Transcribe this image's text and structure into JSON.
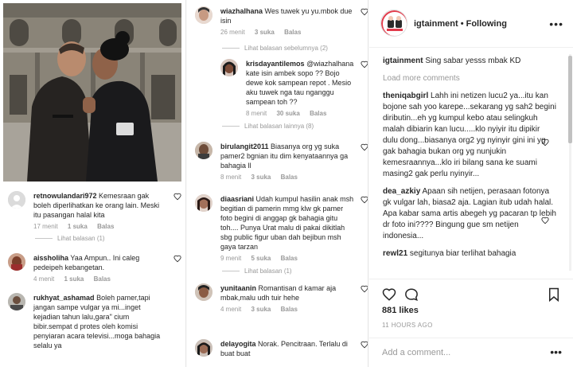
{
  "col1": {
    "comments": [
      {
        "user": "retnowulandari972",
        "text": "Kemesraan gak boleh diperlihatkan ke orang lain. Meski itu pasangan halal kita",
        "time": "17 menit",
        "likes": "1 suka",
        "reply": "Balas"
      },
      {
        "user": "aissholiha",
        "text": "Yaa Ampun.. Ini caleg pedeipeh kebangetan.",
        "time": "4 menit",
        "likes": "1 suka",
        "reply": "Balas"
      },
      {
        "user": "rukhyat_ashamad",
        "text": "Boleh pamer,tapi jangan sampe vulgar ya mi...inget kejadian tahun lalu,gara\" cium bibir.sempat d protes oleh komisi penyiaran acara televisi...moga bahagia selalu ya",
        "time": "",
        "likes": "",
        "reply": ""
      }
    ],
    "view_replies": "Lihat balasan (1)"
  },
  "col2": {
    "comments": [
      {
        "user": "wiazhalhana",
        "text": "Wes tuwek yu yu.mbok due isin",
        "time": "26 menit",
        "likes": "3 suka",
        "reply": "Balas"
      },
      {
        "user": "krisdayantilemos",
        "text": "@wiazhalhana kate isin ambek sopo ?? Bojo dewe kok sampean repot . Mesio aku tuwek nga tau nganggu sampean toh ??",
        "time": "8 menit",
        "likes": "30 suka",
        "reply": "Balas"
      },
      {
        "user": "birulangit2011",
        "text": "Biasanya org yg suka pamer2 bgnian itu dim kenyataannya ga bahagia ll",
        "time": "8 menit",
        "likes": "3 suka",
        "reply": "Balas"
      },
      {
        "user": "diaasriani",
        "text": "Udah kumpul hasilin anak msh begitian di pamerin mmg klw gk pamer foto begini di anggap gk bahagia gitu toh.... Punya Urat malu di pakai dikitlah sbg public figur uban dah bejibun msh gaya tarzan",
        "time": "9 menit",
        "likes": "5 suka",
        "reply": "Balas"
      },
      {
        "user": "yunitaanin",
        "text": "Romantisan d kamar aja mbak,malu udh tuir hehe",
        "time": "4 menit",
        "likes": "3 suka",
        "reply": "Balas"
      },
      {
        "user": "delayogita",
        "text": "Norak. Pencitraan. Terlalu di buat buat",
        "time": "",
        "likes": "",
        "reply": ""
      }
    ],
    "replies_prev": "Lihat balasan sebelumnya (2)",
    "replies_more": "Lihat balasan lainnya (8)",
    "replies_one": "Lihat balasan (1)"
  },
  "post": {
    "account": "igtainment",
    "separator": "•",
    "follow_status": "Following",
    "caption": "Sing sabar yesss mbak KD",
    "load_more": "Load more comments",
    "comments": [
      {
        "user": "theniqabgirl",
        "text": "Lahh ini netizen lucu2 ya...itu kan bojone sah yoo karepe...sekarang yg sah2 begini diributin...eh yg kumpul kebo atau selingkuh malah dibiarin kan lucu.....klo nyiyir itu dipikir dulu dong...biasanya org2 yg nyinyir gini ini yg gak bahagia bukan org yg nunjukin kemesraannya...klo iri bilang sana ke suami masing2 gak perlu nyinyir..."
      },
      {
        "user": "dea_azkiy",
        "text": "Apaan sih netijen, perasaan fotonya gk vulgar lah, biasa2 aja. Lagian itub udah halal. Apa kabar sama artis abegeh yg pacaran tp lebih dr foto ini???? Bingung gue sm netijen indonesia..."
      },
      {
        "user": "rewl21",
        "text": "segitunya biar terlihat bahagia"
      }
    ],
    "likes": "881 likes",
    "time": "11 HOURS AGO",
    "add_comment_placeholder": "Add a comment...",
    "more_icon": "•••"
  }
}
